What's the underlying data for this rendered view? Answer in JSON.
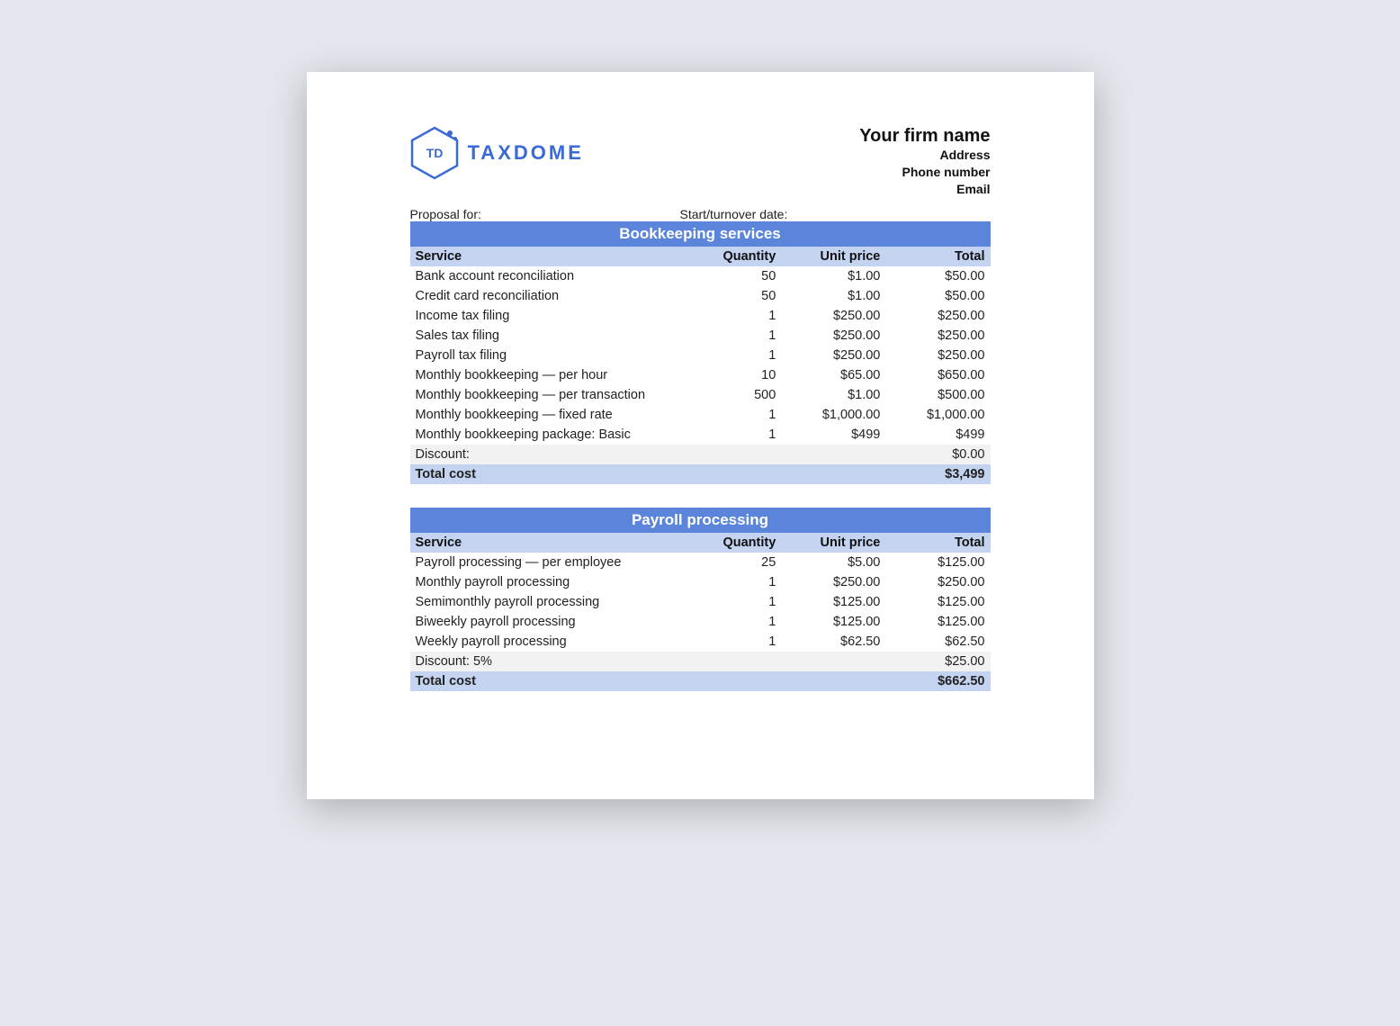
{
  "logo": {
    "badge_text": "TD",
    "brand_text": "TAXDOME"
  },
  "firm": {
    "name": "Your firm name",
    "address": "Address",
    "phone": "Phone number",
    "email": "Email"
  },
  "meta": {
    "proposal_for_label": "Proposal for:",
    "start_date_label": "Start/turnover date:"
  },
  "columns": {
    "service": "Service",
    "quantity": "Quantity",
    "unit_price": "Unit price",
    "total": "Total"
  },
  "sections": [
    {
      "title": "Bookkeeping services",
      "rows": [
        {
          "service": "Bank account reconciliation",
          "quantity": "50",
          "unit_price": "$1.00",
          "total": "$50.00"
        },
        {
          "service": "Credit card reconciliation",
          "quantity": "50",
          "unit_price": "$1.00",
          "total": "$50.00"
        },
        {
          "service": "Income tax filing",
          "quantity": "1",
          "unit_price": "$250.00",
          "total": "$250.00"
        },
        {
          "service": "Sales tax filing",
          "quantity": "1",
          "unit_price": "$250.00",
          "total": "$250.00"
        },
        {
          "service": "Payroll tax filing",
          "quantity": "1",
          "unit_price": "$250.00",
          "total": "$250.00"
        },
        {
          "service": "Monthly bookkeeping — per hour",
          "quantity": "10",
          "unit_price": "$65.00",
          "total": "$650.00"
        },
        {
          "service": "Monthly bookkeeping — per transaction",
          "quantity": "500",
          "unit_price": "$1.00",
          "total": "$500.00"
        },
        {
          "service": "Monthly bookkeeping — fixed rate",
          "quantity": "1",
          "unit_price": "$1,000.00",
          "total": "$1,000.00"
        },
        {
          "service": "Monthly bookkeeping package: Basic",
          "quantity": "1",
          "unit_price": "$499",
          "total": "$499"
        }
      ],
      "discount": {
        "label": "Discount:",
        "amount": "$0.00"
      },
      "total": {
        "label": "Total cost",
        "amount": "$3,499"
      }
    },
    {
      "title": "Payroll processing",
      "rows": [
        {
          "service": "Payroll processing — per employee",
          "quantity": "25",
          "unit_price": "$5.00",
          "total": "$125.00"
        },
        {
          "service": "Monthly payroll processing",
          "quantity": "1",
          "unit_price": "$250.00",
          "total": "$250.00"
        },
        {
          "service": "Semimonthly payroll processing",
          "quantity": "1",
          "unit_price": "$125.00",
          "total": "$125.00"
        },
        {
          "service": "Biweekly payroll processing",
          "quantity": "1",
          "unit_price": "$125.00",
          "total": "$125.00"
        },
        {
          "service": "Weekly payroll processing",
          "quantity": "1",
          "unit_price": "$62.50",
          "total": "$62.50"
        }
      ],
      "discount": {
        "label": "Discount: 5%",
        "amount": "$25.00"
      },
      "total": {
        "label": "Total cost",
        "amount": "$662.50"
      }
    }
  ]
}
